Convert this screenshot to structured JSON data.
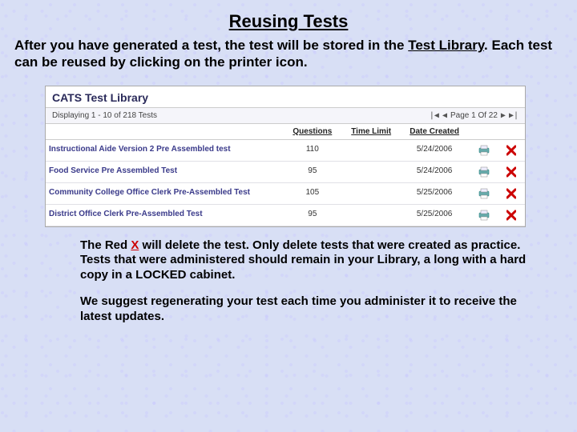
{
  "title": "Reusing Tests",
  "intro_pre": "After you have generated a test, the test will be stored in the ",
  "intro_link": "Test Library",
  "intro_post": ".  Each test can be reused by clicking on the printer icon.",
  "library": {
    "heading": "CATS Test Library",
    "display_text": "Displaying 1 - 10 of 218 Tests",
    "page_text": "Page 1 Of 22",
    "columns": {
      "name": "",
      "questions": "Questions",
      "time": "Time Limit",
      "date": "Date Created"
    },
    "rows": [
      {
        "name": "Instructional Aide Version 2 Pre Assembled test",
        "questions": "110",
        "time": "",
        "date": "5/24/2006"
      },
      {
        "name": "Food Service Pre Assembled Test",
        "questions": "95",
        "time": "",
        "date": "5/24/2006"
      },
      {
        "name": "Community College Office Clerk Pre-Assembled Test",
        "questions": "105",
        "time": "",
        "date": "5/25/2006"
      },
      {
        "name": "District Office Clerk Pre-Assembled Test",
        "questions": "95",
        "time": "",
        "date": "5/25/2006"
      }
    ]
  },
  "body1_pre": "The Red ",
  "body1_x": "X",
  "body1_post": " will delete the test.  Only delete tests that were created as practice.  Tests that were administered should remain in your Library, a long with a hard copy in a LOCKED cabinet.",
  "body2": "We suggest regenerating your test each time you administer it to receive the latest updates."
}
